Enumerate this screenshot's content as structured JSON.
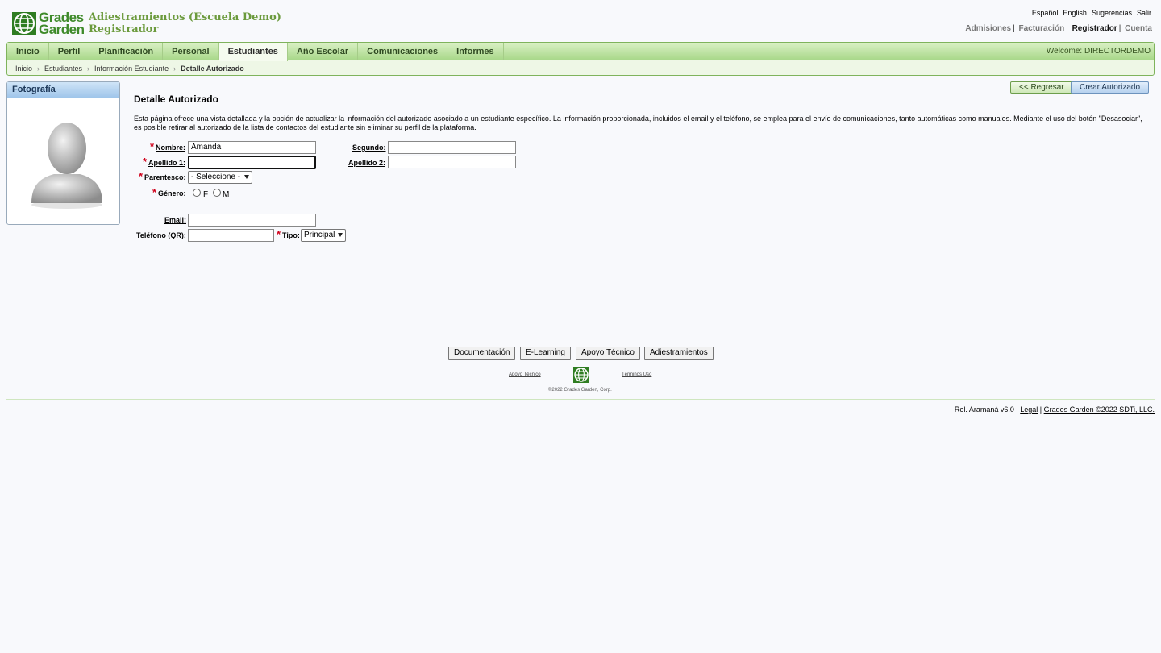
{
  "brand": {
    "line1": "Grades",
    "line2": "Garden"
  },
  "school": {
    "name": "Adiestramientos (Escuela Demo)",
    "module": "Registrador"
  },
  "toplinks": [
    "Español",
    "English",
    "Sugerencias",
    "Salir"
  ],
  "modules": [
    "Admisiones",
    "Facturación",
    "Registrador",
    "Cuenta"
  ],
  "nav": {
    "tabs": [
      "Inicio",
      "Perfil",
      "Planificación",
      "Personal",
      "Estudiantes",
      "Año Escolar",
      "Comunicaciones",
      "Informes"
    ],
    "welcome": "Welcome: DIRECTORDEMO"
  },
  "breadcrumb": [
    "Inicio",
    "Estudiantes",
    "Información Estudiante",
    "Detalle Autorizado"
  ],
  "sidebar": {
    "title": "Fotografía"
  },
  "actions": {
    "back": "<< Regresar",
    "create": "Crear Autorizado"
  },
  "page": {
    "title": "Detalle Autorizado",
    "description": "Esta página ofrece una vista detallada y la opción de actualizar la información del autorizado asociado a un estudiante específico. La información proporcionada, incluidos el email y el teléfono, se emplea para el envío de comunicaciones, tanto automáticas como manuales. Mediante el uso del botón \"Desasociar\", es posible retirar al autorizado de la lista de contactos del estudiante sin eliminar su perfil de la plataforma."
  },
  "form": {
    "nombre_label": "Nombre:",
    "nombre_value": "Amanda",
    "segundo_label": "Segundo:",
    "segundo_value": "",
    "apellido1_label": "Apellido 1:",
    "apellido1_value": "",
    "apellido2_label": "Apellido 2:",
    "apellido2_value": "",
    "parentesco_label": "Parentesco:",
    "parentesco_value": "- Seleccione -",
    "genero_label": "Género:",
    "genero_f": "F",
    "genero_m": "M",
    "email_label": "Email:",
    "email_value": "",
    "telefono_label": "Teléfono (QR):",
    "telefono_value": "",
    "tipo_label": "Tipo:",
    "tipo_value": "Principal",
    "required_mark": "*"
  },
  "footer": {
    "buttons": [
      "Documentación",
      "E-Learning",
      "Apoyo Técnico",
      "Adiestramientos"
    ],
    "link_support": "Apoyo Técnico",
    "link_terms": "Términos Uso",
    "copyright": "©2022 Grades Garden, Corp.",
    "release": "Rel. Aramaná v6.0",
    "legal": "Legal",
    "company": "Grades Garden ©2022 SDTi, LLC."
  },
  "colors": {
    "brand_green": "#3e8a2a",
    "required_red": "#d0001a",
    "tab_green": "#a9d88a"
  }
}
